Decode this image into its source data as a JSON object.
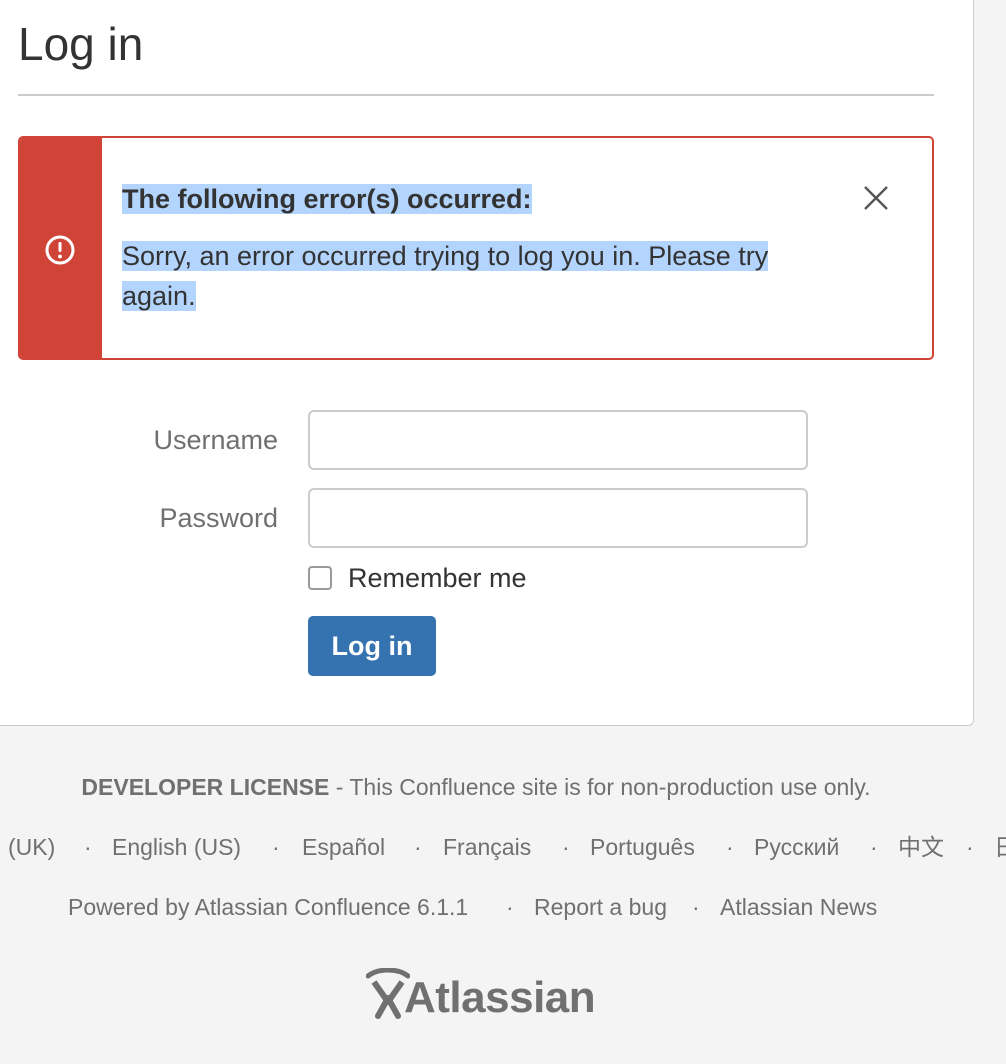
{
  "page": {
    "title": "Log in"
  },
  "error": {
    "heading": "The following error(s) occurred:",
    "message": "Sorry, an error occurred trying to log you in. Please try again.",
    "icon": "error-icon",
    "color": "#d04437"
  },
  "form": {
    "username_label": "Username",
    "username_value": "",
    "password_label": "Password",
    "password_value": "",
    "remember_label": "Remember me",
    "remember_checked": false,
    "submit_label": "Log in",
    "submit_color": "#3572b0"
  },
  "footer": {
    "license_strong": "DEVELOPER LICENSE",
    "license_text": " - This Confluence site is for non-production use only.",
    "languages": [
      "(UK)",
      "English (US)",
      "Español",
      "Français",
      "Português",
      "Русский",
      "中文",
      "日"
    ],
    "separator": "·",
    "links": [
      "Powered by Atlassian Confluence 6.1.1",
      "Report a bug",
      "Atlassian News"
    ],
    "logo_text": "Atlassian"
  }
}
